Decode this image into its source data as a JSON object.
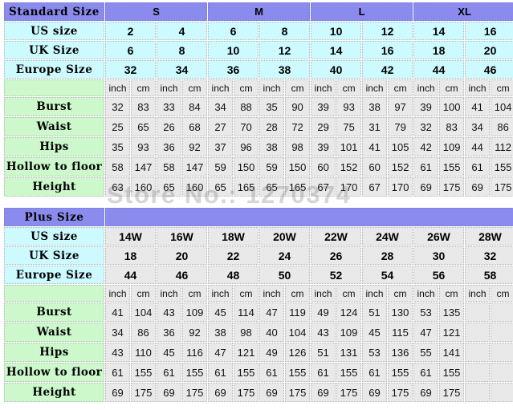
{
  "watermark": "Store No.: 1270374",
  "units": [
    "inch",
    "cm"
  ],
  "standard": {
    "title": "Standard Size",
    "groups": [
      {
        "label": "S",
        "span": 2
      },
      {
        "label": "M",
        "span": 2
      },
      {
        "label": "L",
        "span": 2
      },
      {
        "label": "XL",
        "span": 2
      }
    ],
    "size_rows": [
      {
        "label": "US size",
        "values": [
          "2",
          "4",
          "6",
          "8",
          "10",
          "12",
          "14",
          "16"
        ]
      },
      {
        "label": "UK Size",
        "values": [
          "6",
          "8",
          "10",
          "12",
          "14",
          "16",
          "18",
          "20"
        ]
      },
      {
        "label": "Europe Size",
        "values": [
          "32",
          "34",
          "36",
          "38",
          "40",
          "42",
          "44",
          "46"
        ]
      }
    ],
    "measure_rows": [
      {
        "label": "Burst",
        "values": [
          "32",
          "83",
          "33",
          "84",
          "34",
          "88",
          "35",
          "90",
          "39",
          "93",
          "38",
          "97",
          "39",
          "100",
          "41",
          "104"
        ]
      },
      {
        "label": "Waist",
        "values": [
          "25",
          "65",
          "26",
          "68",
          "27",
          "70",
          "28",
          "72",
          "29",
          "75",
          "31",
          "79",
          "32",
          "83",
          "34",
          "86"
        ]
      },
      {
        "label": "Hips",
        "values": [
          "35",
          "93",
          "36",
          "92",
          "37",
          "96",
          "38",
          "98",
          "39",
          "101",
          "41",
          "105",
          "42",
          "109",
          "44",
          "112"
        ]
      },
      {
        "label": "Hollow to floor",
        "values": [
          "58",
          "147",
          "58",
          "147",
          "59",
          "150",
          "59",
          "150",
          "60",
          "152",
          "60",
          "152",
          "61",
          "155",
          "61",
          "155"
        ]
      },
      {
        "label": "Height",
        "values": [
          "63",
          "160",
          "65",
          "160",
          "65",
          "165",
          "65",
          "165",
          "67",
          "170",
          "67",
          "170",
          "69",
          "175",
          "69",
          "175"
        ]
      }
    ]
  },
  "plus": {
    "title": "Plus Size",
    "size_rows": [
      {
        "label": "US size",
        "values": [
          "14W",
          "16W",
          "18W",
          "20W",
          "22W",
          "24W",
          "26W",
          "28W"
        ]
      },
      {
        "label": "UK Size",
        "values": [
          "18",
          "20",
          "22",
          "24",
          "26",
          "28",
          "30",
          "32"
        ]
      },
      {
        "label": "Europe Size",
        "values": [
          "44",
          "46",
          "48",
          "50",
          "52",
          "54",
          "56",
          "58"
        ]
      }
    ],
    "measure_rows": [
      {
        "label": "Burst",
        "values": [
          "41",
          "104",
          "43",
          "109",
          "45",
          "114",
          "47",
          "119",
          "49",
          "124",
          "51",
          "130",
          "53",
          "135",
          "",
          ""
        ]
      },
      {
        "label": "Waist",
        "values": [
          "34",
          "86",
          "36",
          "92",
          "38",
          "98",
          "40",
          "104",
          "43",
          "109",
          "45",
          "115",
          "47",
          "121",
          "",
          ""
        ]
      },
      {
        "label": "Hips",
        "values": [
          "43",
          "110",
          "45",
          "116",
          "47",
          "121",
          "49",
          "126",
          "51",
          "131",
          "53",
          "136",
          "55",
          "141",
          "",
          ""
        ]
      },
      {
        "label": "Hollow to floor",
        "values": [
          "61",
          "155",
          "61",
          "155",
          "61",
          "155",
          "61",
          "155",
          "61",
          "155",
          "61",
          "155",
          "61",
          "155",
          "",
          ""
        ]
      },
      {
        "label": "Height",
        "values": [
          "69",
          "175",
          "69",
          "175",
          "69",
          "175",
          "69",
          "175",
          "69",
          "175",
          "69",
          "175",
          "69",
          "175",
          "",
          ""
        ]
      }
    ]
  },
  "colors": {
    "header_purple": "#8b8bee",
    "size_cyan": "#ccfaff",
    "label_green": "#ccf8cc",
    "data_gray": "#e9e9e9"
  }
}
